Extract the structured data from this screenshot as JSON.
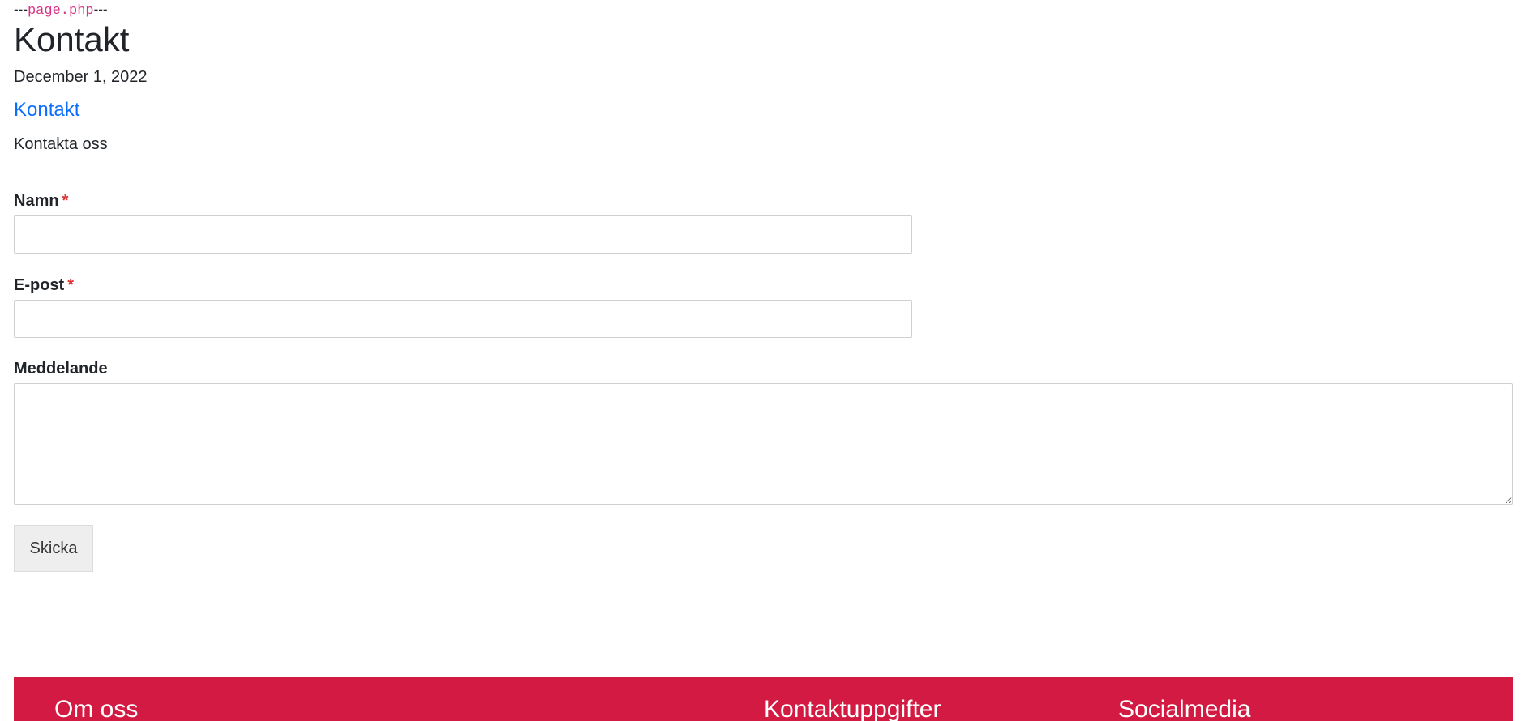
{
  "debug": {
    "prefix": "---",
    "filename": "page.php",
    "suffix": "---"
  },
  "page": {
    "title": "Kontakt",
    "date": "December 1, 2022",
    "post_link": "Kontakt",
    "intro": "Kontakta oss"
  },
  "form": {
    "name_label": "Namn",
    "email_label": "E-post",
    "message_label": "Meddelande",
    "required_mark": "*",
    "name_value": "",
    "email_value": "",
    "message_value": "",
    "submit_label": "Skicka"
  },
  "footer": {
    "background_color": "#d31a42",
    "about_heading": "Om oss",
    "contact_heading": "Kontaktuppgifter",
    "social_heading": "Socialmedia"
  }
}
